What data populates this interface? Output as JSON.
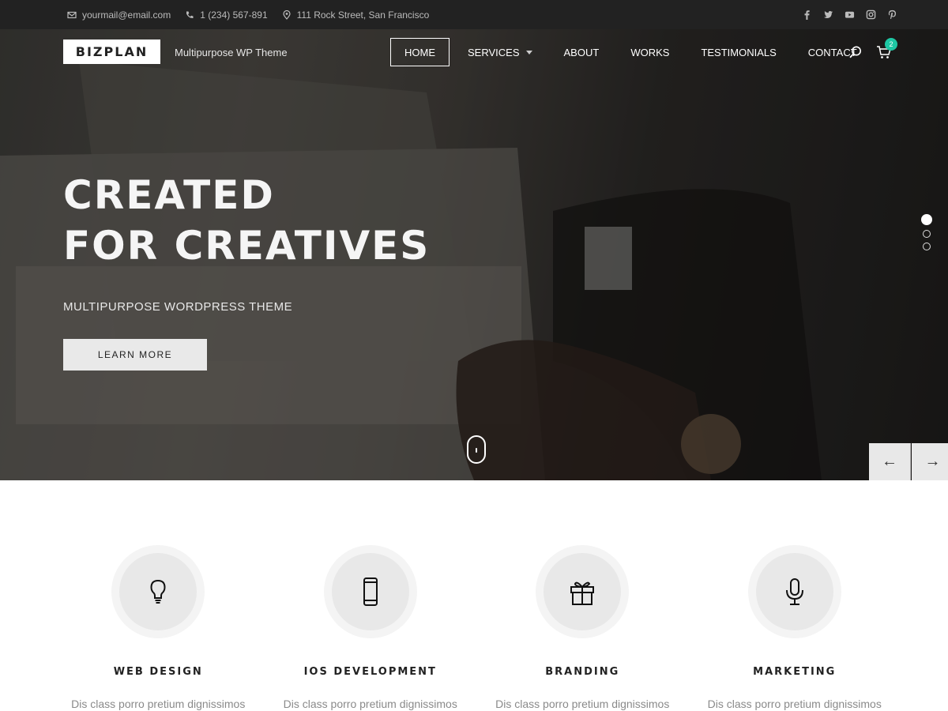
{
  "topbar": {
    "email": "yourmail@email.com",
    "phone": "1 (234) 567-891",
    "address": "111 Rock Street, San Francisco",
    "social_icons": [
      "facebook-icon",
      "twitter-icon",
      "youtube-icon",
      "instagram-icon",
      "pinterest-icon"
    ]
  },
  "header": {
    "logo": "BIZPLAN",
    "tagline": "Multipurpose WP Theme",
    "nav": [
      {
        "label": "HOME",
        "active": true
      },
      {
        "label": "SERVICES"
      },
      {
        "label": "ABOUT"
      },
      {
        "label": "WORKS"
      },
      {
        "label": "TESTIMONIALS"
      },
      {
        "label": "CONTACT"
      }
    ],
    "cart_count": "2"
  },
  "hero": {
    "headline_line1": "CREATED",
    "headline_line2": "FOR CREATIVES",
    "subheadline": "MULTIPURPOSE WORDPRESS THEME",
    "cta_label": "LEARN MORE",
    "slide_count": 3,
    "active_slide": 1,
    "prev_arrow": "←",
    "next_arrow": "→"
  },
  "services": [
    {
      "title": "WEB DESIGN",
      "desc": "Dis class porro pretium dignissimos",
      "icon": "lightbulb-icon"
    },
    {
      "title": "IOS DEVELOPMENT",
      "desc": "Dis class porro pretium dignissimos",
      "icon": "smartphone-icon"
    },
    {
      "title": "BRANDING",
      "desc": "Dis class porro pretium dignissimos",
      "icon": "gift-icon"
    },
    {
      "title": "MARKETING",
      "desc": "Dis class porro pretium dignissimos",
      "icon": "microphone-icon"
    }
  ],
  "colors": {
    "topbar_bg": "#222222",
    "accent_badge": "#1ec7a4",
    "button_bg": "#e9e9e9"
  }
}
